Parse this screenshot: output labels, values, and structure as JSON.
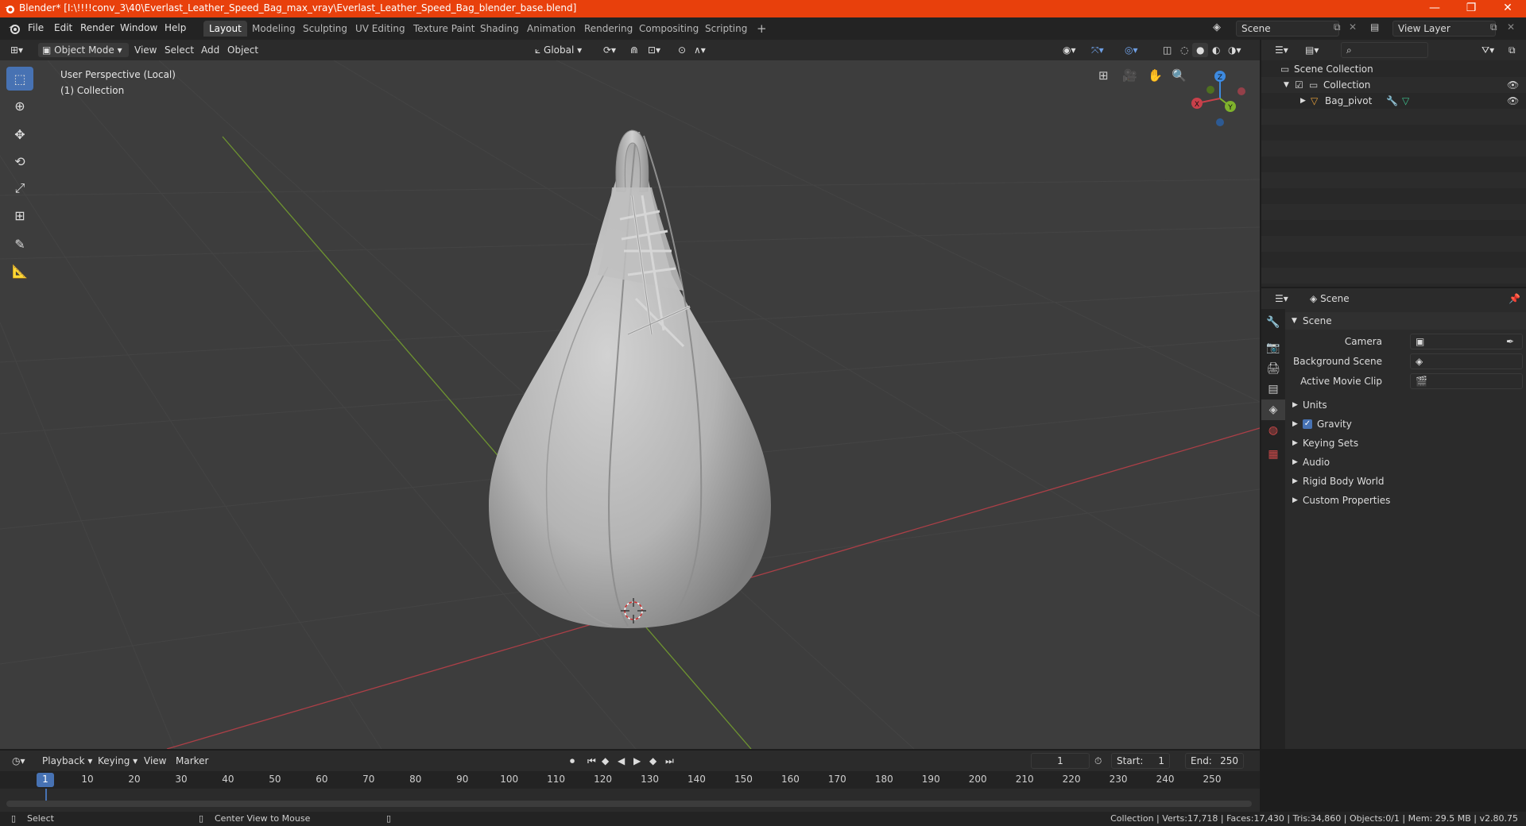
{
  "titlebar": {
    "title": "Blender* [I:\\!!!!conv_3\\40\\Everlast_Leather_Speed_Bag_max_vray\\Everlast_Leather_Speed_Bag_blender_base.blend]",
    "minimize": "—",
    "maximize": "❐",
    "close": "✕",
    "bg_color": "#e8400c"
  },
  "menu": [
    "File",
    "Edit",
    "Render",
    "Window",
    "Help"
  ],
  "workspaces": [
    "Layout",
    "Modeling",
    "Sculpting",
    "UV Editing",
    "Texture Paint",
    "Shading",
    "Animation",
    "Rendering",
    "Compositing",
    "Scripting"
  ],
  "workspace_add": "+",
  "scene_field": "Scene",
  "view_layer_field": "View Layer",
  "viewport_header": {
    "mode": "Object Mode",
    "menus": [
      "View",
      "Select",
      "Add",
      "Object"
    ],
    "transform_orientation": "Global"
  },
  "viewport": {
    "info_line1": "User Perspective (Local)",
    "info_line2": "(1) Collection",
    "gizmo": {
      "x": "X",
      "y": "Y",
      "z": "Z"
    }
  },
  "outliner": {
    "search_placeholder": "",
    "scene_collection": "Scene Collection",
    "collection": "Collection",
    "object": "Bag_pivot"
  },
  "properties": {
    "breadcrumb": "Scene",
    "panel_title": "Scene",
    "fields": [
      {
        "label": "Camera",
        "value": ""
      },
      {
        "label": "Background Scene",
        "value": ""
      },
      {
        "label": "Active Movie Clip",
        "value": ""
      }
    ],
    "sections": [
      "Units",
      "Gravity",
      "Keying Sets",
      "Audio",
      "Rigid Body World",
      "Custom Properties"
    ],
    "gravity_checked": true
  },
  "timeline": {
    "menus": [
      "Playback",
      "Keying",
      "View",
      "Marker"
    ],
    "current_frame": "1",
    "start_label": "Start:",
    "start": "1",
    "end_label": "End:",
    "end": "250",
    "ticks": [
      "1",
      "10",
      "20",
      "30",
      "40",
      "50",
      "60",
      "70",
      "80",
      "90",
      "100",
      "110",
      "120",
      "130",
      "140",
      "150",
      "160",
      "170",
      "180",
      "190",
      "200",
      "210",
      "220",
      "230",
      "240",
      "250"
    ]
  },
  "statusbar": {
    "left1": "Select",
    "left2": "Center View to Mouse",
    "right": "Collection | Verts:17,718 | Faces:17,430 | Tris:34,860 | Objects:0/1 | Mem: 29.5 MB | v2.80.75"
  },
  "colors": {
    "accent": "#4772b3",
    "axis_x": "#c8404a",
    "axis_y": "#7fb22c",
    "axis_z": "#3d8ae0"
  }
}
